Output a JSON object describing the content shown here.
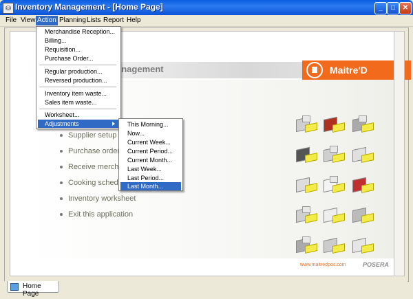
{
  "window": {
    "title": "Inventory Management - [Home Page]"
  },
  "menubar": {
    "items": [
      "File",
      "View",
      "Action",
      "Planning",
      "Lists",
      "Report",
      "Help"
    ]
  },
  "action_menu": {
    "items": [
      "Merchandise Reception...",
      "Billing...",
      "Requisition...",
      "Purchase Order...",
      "Regular production...",
      "Reversed production...",
      "Inventory item waste...",
      "Sales item waste...",
      "Worksheet...",
      "Adjustments"
    ]
  },
  "adjustments_menu": {
    "items": [
      "This Morning...",
      "Now...",
      "Current Week...",
      "Current Period...",
      "Current Month...",
      "Last Week...",
      "Last Period...",
      "Last Month..."
    ]
  },
  "banner": {
    "title": "anagement",
    "brand": "Maitre'D"
  },
  "links": [
    "Supplier setup",
    "Purchase order",
    "Receive merchandis",
    "Cooking schedule",
    "Inventory worksheet",
    "Exit this application"
  ],
  "footer": {
    "url": "www.maitredpos.com",
    "brand": "POSERA"
  },
  "tabs": [
    {
      "label": "Home Page"
    }
  ],
  "colors": {
    "accent": "#F26B1D",
    "selection": "#316AC5",
    "titlebar": "#0A5CE0"
  }
}
